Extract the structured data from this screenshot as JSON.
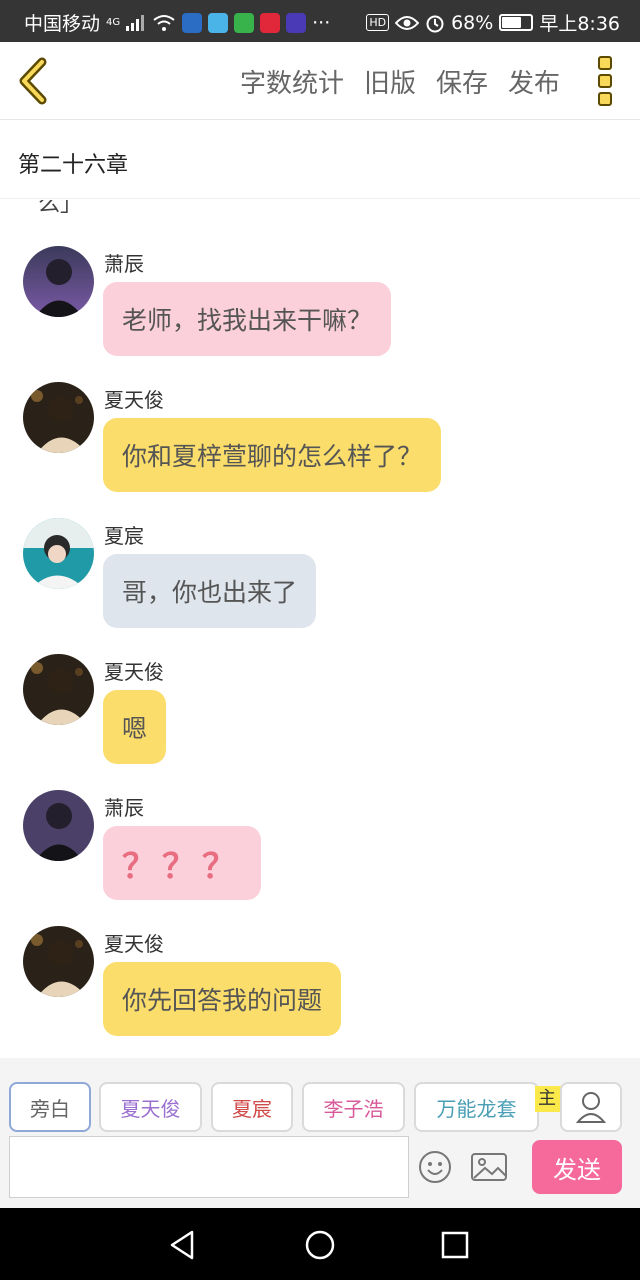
{
  "status": {
    "carrier": "中国移动",
    "network": "4G",
    "battery": "68%",
    "battery_level": 0.68,
    "time": "早上8:36",
    "hd": "HD",
    "dots": "···"
  },
  "toolbar": {
    "word_count": "字数统计",
    "old_version": "旧版",
    "save": "保存",
    "publish": "发布"
  },
  "chapter": {
    "title": "第二十六章"
  },
  "cut_text": "么」",
  "messages": [
    {
      "name": "萧辰",
      "text": "老师，找我出来干嘛？",
      "style": "pink"
    },
    {
      "name": "夏天俊",
      "text": "你和夏梓萱聊的怎么样了？",
      "style": "yellow"
    },
    {
      "name": "夏宸",
      "text": "哥，你也出来了",
      "style": "grey"
    },
    {
      "name": "夏天俊",
      "text": "嗯",
      "style": "yellow"
    },
    {
      "name": "萧辰",
      "text": "？？？",
      "style": "pink"
    },
    {
      "name": "夏天俊",
      "text": "你先回答我的问题",
      "style": "yellow"
    }
  ],
  "characters": [
    {
      "label": "旁白",
      "color": "#666666"
    },
    {
      "label": "夏天俊",
      "color": "#9b6fd0"
    },
    {
      "label": "夏宸",
      "color": "#d04a4a"
    },
    {
      "label": "李子浩",
      "color": "#d85a9a"
    },
    {
      "label": "万能龙套",
      "color": "#4a9fb5"
    }
  ],
  "composer": {
    "role_tag": "主",
    "send": "发送",
    "input_value": ""
  },
  "colors": {
    "pink_bubble": "#fbd0da",
    "yellow_bubble": "#fadd6a",
    "grey_bubble": "#dfe5ed",
    "send_button": "#f56a9b"
  }
}
